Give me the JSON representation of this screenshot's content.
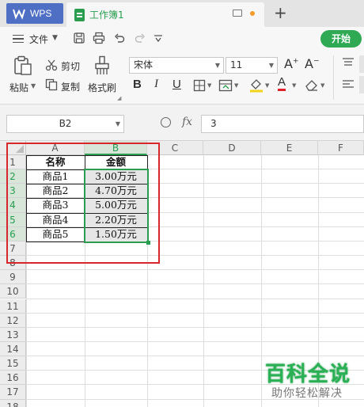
{
  "titlebar": {
    "app_tab": "WPS",
    "doc_tab": "工作簿1",
    "new_tab": "+"
  },
  "menu": {
    "file": "文件",
    "start": "开始"
  },
  "ribbon": {
    "paste": "粘贴",
    "cut": "剪切",
    "copy": "复制",
    "format_painter": "格式刷",
    "font_name": "宋体",
    "font_size": "11",
    "bold": "B",
    "italic": "I",
    "underline": "U"
  },
  "formula": {
    "name_box": "B2",
    "fx": "fx",
    "value": "3"
  },
  "grid": {
    "columns": [
      "A",
      "B",
      "C",
      "D",
      "E",
      "F"
    ],
    "rows": [
      "1",
      "2",
      "3",
      "4",
      "5",
      "6",
      "7",
      "8",
      "9",
      "10",
      "11",
      "12",
      "13",
      "14",
      "15",
      "16",
      "17",
      "18"
    ],
    "header": [
      "名称",
      "金额"
    ],
    "data": [
      [
        "商品1",
        "3.00万元"
      ],
      [
        "商品2",
        "4.70万元"
      ],
      [
        "商品3",
        "5.00万元"
      ],
      [
        "商品4",
        "2.20万元"
      ],
      [
        "商品5",
        "1.50万元"
      ]
    ]
  },
  "watermark": {
    "title_a": "百科",
    "title_b": "全说",
    "subtitle": "助你轻松解决"
  },
  "colors": {
    "accent_green": "#2a9d50",
    "wps_blue": "#4f6fc4",
    "annotation_red": "#d7262c"
  }
}
